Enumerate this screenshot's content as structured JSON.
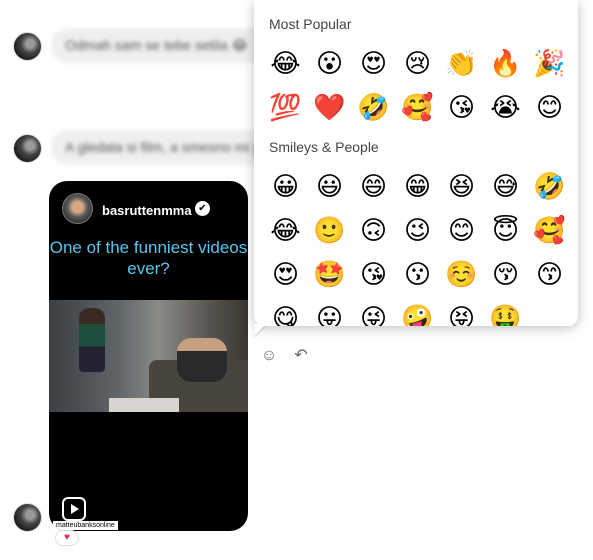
{
  "messages": [
    {
      "text": "Odmah sam se tebe setila 😂"
    },
    {
      "text": "A gledala si film, a smesno mi je bilo"
    }
  ],
  "reel": {
    "username": "basruttenmma",
    "caption": "One of the funniest videos ever?",
    "credit": "matteubanksonline",
    "verified_mark": "✔",
    "reaction": "♥"
  },
  "actions": {
    "emoji_button": "☺",
    "reply_button": "↶"
  },
  "emoji_picker": {
    "most_popular_title": "Most Popular",
    "most_popular": [
      "😂",
      "😮",
      "😍",
      "😢",
      "👏",
      "🔥",
      "🎉",
      "💯",
      "❤️",
      "🤣",
      "🥰",
      "😘",
      "😭",
      "😊"
    ],
    "smileys_title": "Smileys & People",
    "smileys": [
      "😀",
      "😃",
      "😄",
      "😁",
      "😆",
      "😅",
      "🤣",
      "😂",
      "🙂",
      "🙃",
      "😉",
      "😊",
      "😇",
      "🥰",
      "😍",
      "🤩",
      "😘",
      "😗",
      "☺️",
      "😚",
      "😙",
      "😋",
      "😛",
      "😜",
      "🤪",
      "😝",
      "🤑"
    ]
  }
}
